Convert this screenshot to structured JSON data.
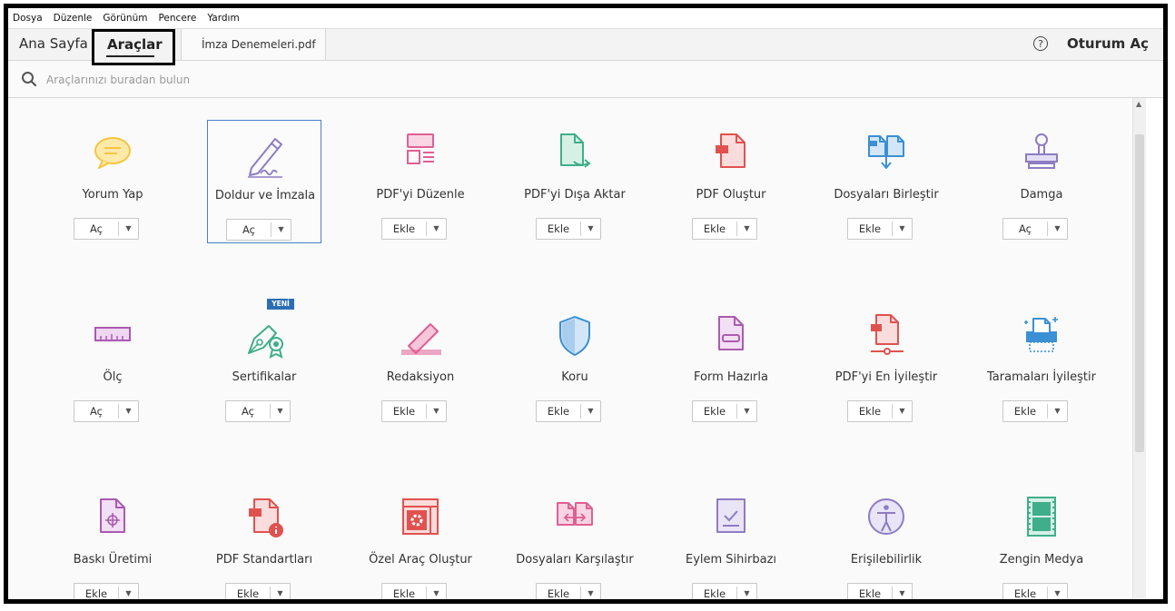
{
  "menu": [
    "Dosya",
    "Düzenle",
    "Görünüm",
    "Pencere",
    "Yardım"
  ],
  "tabs": {
    "home": "Ana Sayfa",
    "tools": "Araçlar",
    "document": "İmza Denemeleri.pdf"
  },
  "header": {
    "help": "?",
    "signin": "Oturum Aç"
  },
  "search": {
    "placeholder": "Araçlarınızı buradan bulun"
  },
  "badge": "YENİ",
  "tools": [
    {
      "label": "Yorum Yap",
      "button": "Aç",
      "icon": "comment-icon"
    },
    {
      "label": "Doldur ve İmzala",
      "button": "Aç",
      "icon": "fill-sign-icon"
    },
    {
      "label": "PDF'yi Düzenle",
      "button": "Ekle",
      "icon": "edit-pdf-icon"
    },
    {
      "label": "PDF'yi Dışa Aktar",
      "button": "Ekle",
      "icon": "export-pdf-icon"
    },
    {
      "label": "PDF Oluştur",
      "button": "Ekle",
      "icon": "create-pdf-icon"
    },
    {
      "label": "Dosyaları Birleştir",
      "button": "Ekle",
      "icon": "combine-files-icon"
    },
    {
      "label": "Damga",
      "button": "Aç",
      "icon": "stamp-icon"
    },
    {
      "label": "Ölç",
      "button": "Aç",
      "icon": "measure-icon"
    },
    {
      "label": "Sertifikalar",
      "button": "Aç",
      "icon": "certificates-icon"
    },
    {
      "label": "Redaksiyon",
      "button": "Ekle",
      "icon": "redact-icon"
    },
    {
      "label": "Koru",
      "button": "Ekle",
      "icon": "protect-icon"
    },
    {
      "label": "Form Hazırla",
      "button": "Ekle",
      "icon": "prepare-form-icon"
    },
    {
      "label": "PDF'yi En İyileştir",
      "button": "Ekle",
      "icon": "optimize-pdf-icon"
    },
    {
      "label": "Taramaları İyileştir",
      "button": "Ekle",
      "icon": "enhance-scans-icon"
    },
    {
      "label": "Baskı Üretimi",
      "button": "Ekle",
      "icon": "print-production-icon"
    },
    {
      "label": "PDF Standartları",
      "button": "Ekle",
      "icon": "pdf-standards-icon"
    },
    {
      "label": "Özel Araç Oluştur",
      "button": "Ekle",
      "icon": "custom-tool-icon"
    },
    {
      "label": "Dosyaları Karşılaştır",
      "button": "Ekle",
      "icon": "compare-files-icon"
    },
    {
      "label": "Eylem Sihirbazı",
      "button": "Ekle",
      "icon": "action-wizard-icon"
    },
    {
      "label": "Erişilebilirlik",
      "button": "Ekle",
      "icon": "accessibility-icon"
    },
    {
      "label": "Zengin Medya",
      "button": "Ekle",
      "icon": "rich-media-icon"
    }
  ],
  "colors": {
    "accent": "#4a7fcf",
    "comment": "#f5c544",
    "fill_sign": "#8e7cc3",
    "edit": "#e05f93",
    "export": "#3fae8a",
    "create": "#e0524f",
    "combine": "#3b8fd4",
    "stamp": "#8e7cc3",
    "measure": "#a95bb0",
    "certificates": "#3fae8a",
    "redact": "#e05f93",
    "protect": "#3b8fd4",
    "form": "#a95bb0",
    "optimize": "#e0524f",
    "scans": "#3b8fd4",
    "print": "#a95bb0",
    "standards": "#e0524f",
    "custom": "#e0524f",
    "compare": "#e05f93",
    "action": "#8e7cc3",
    "access": "#8e7cc3",
    "media": "#3fae8a"
  }
}
